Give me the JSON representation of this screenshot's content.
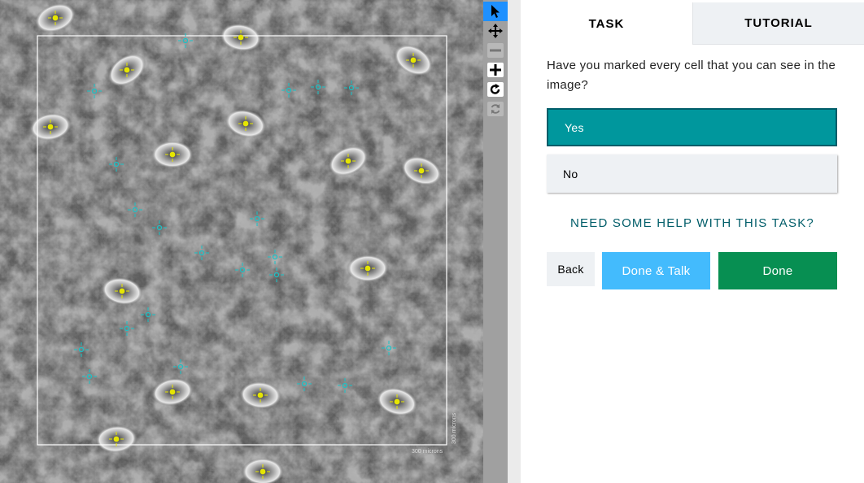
{
  "viewer": {
    "scale_bar_horizontal": "300 microns",
    "scale_bar_vertical": "300 microns",
    "colors": {
      "stomata_marker": "#e6e600",
      "cell_marker": "#19c3c8",
      "frame": "#ffffff"
    }
  },
  "toolbar": {
    "tools": [
      {
        "name": "select-pointer-icon",
        "active": true
      },
      {
        "name": "move-pan-icon",
        "active": false
      },
      {
        "name": "zoom-out-icon",
        "active": false,
        "disabled": true
      },
      {
        "name": "zoom-in-icon",
        "active": false
      },
      {
        "name": "rotate-icon",
        "active": false
      },
      {
        "name": "reset-view-icon",
        "active": false,
        "disabled": true
      }
    ],
    "colors": {
      "active": "#1e90ff",
      "background": "#a0a0a0"
    }
  },
  "panel": {
    "tabs": [
      {
        "label": "TASK",
        "selected": true
      },
      {
        "label": "TUTORIAL",
        "selected": false
      }
    ],
    "question": "Have you marked every cell that you can see in the image?",
    "answers": [
      {
        "label": "Yes",
        "selected": true
      },
      {
        "label": "No",
        "selected": false
      }
    ],
    "help_link": "NEED SOME HELP WITH THIS TASK?",
    "buttons": {
      "back": "Back",
      "done_talk": "Done & Talk",
      "done": "Done"
    },
    "colors": {
      "selected_answer": "#00979d",
      "help_link": "#005d69",
      "done_talk": "#43bbfd",
      "done": "#078f52"
    }
  }
}
